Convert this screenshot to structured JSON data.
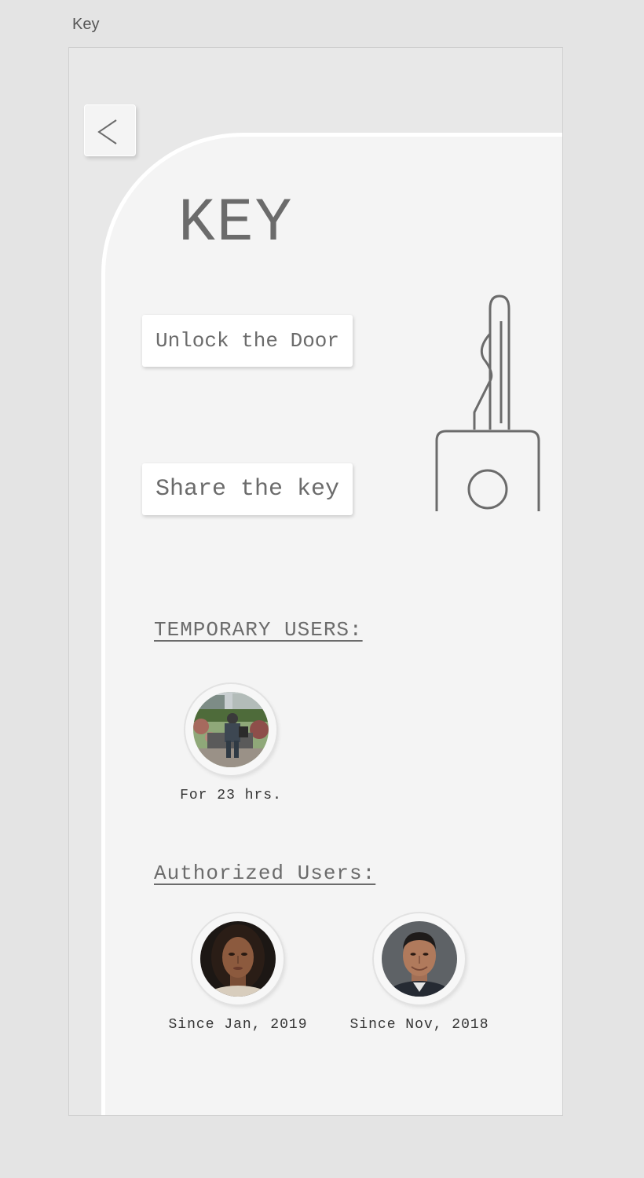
{
  "artboard": {
    "label": "Key"
  },
  "header": {
    "back_icon": "chevron-left-icon",
    "title": "KEY"
  },
  "actions": {
    "unlock_label": "Unlock the Door",
    "share_label": "Share the key"
  },
  "key_illustration": {
    "icon": "key-icon"
  },
  "temporary_users": {
    "heading": "TEMPORARY USERS:",
    "users": [
      {
        "caption": "For 23 hrs.",
        "avatar": "user-photo-park-bench"
      }
    ]
  },
  "authorized_users": {
    "heading": "Authorized Users:",
    "users": [
      {
        "caption": "Since Jan, 2019",
        "avatar": "user-photo-woman"
      },
      {
        "caption": "Since Nov, 2018",
        "avatar": "user-photo-man"
      }
    ]
  },
  "colors": {
    "background": "#e4e4e4",
    "frame": "#e8e8e8",
    "panel": "#f4f4f4",
    "text": "#6b6b6b",
    "button": "#ffffff"
  }
}
